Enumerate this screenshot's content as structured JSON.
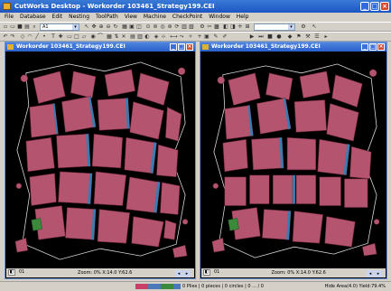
{
  "app": {
    "title": "CutWorks Desktop - Workorder 103461_Strategy199.CEI"
  },
  "menu": [
    "File",
    "Database",
    "Edit",
    "Nesting",
    "ToolPath",
    "View",
    "Machine",
    "CheckPoint",
    "Window",
    "Help"
  ],
  "toolbar": {
    "combo_value": "A1"
  },
  "windows": [
    {
      "title": "Workorder 103461_Strategy199.CEI",
      "zoom": "Zoom: 0%",
      "coord": "X:14.0  Y:62.6",
      "page": "01"
    },
    {
      "title": "Workorder 103461_Strategy199.CEI",
      "zoom": "Zoom: 0%",
      "coord": "X:14.0  Y:62.6",
      "page": "01"
    }
  ],
  "status": {
    "info": "0 Plies | 0 pieces | 0 circles | 0 ... / 0",
    "right": "Hide Area(4.0) Yield:79.4%",
    "colors": [
      "#c8406a",
      "#4a78b8",
      "#3b8a3b",
      "#4a78b8"
    ]
  },
  "colors": {
    "piece_fill": "#b4546e",
    "piece_stroke": "#5a1f30",
    "edge_blue": "#3c7bb0",
    "hide_outline": "#d8d8d8",
    "special_piece": "#3b8a3b"
  }
}
